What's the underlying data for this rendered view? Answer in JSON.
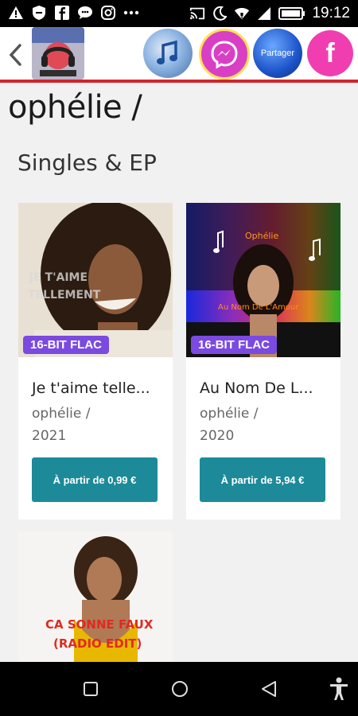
{
  "status_bar": {
    "time": "19:12",
    "icons": [
      "warning-icon",
      "shield-icon",
      "facebook-icon",
      "chat-icon",
      "instagram-icon",
      "more-icon",
      "cast-icon",
      "moon-icon",
      "wifi-icon",
      "signal-icon",
      "battery-icon"
    ]
  },
  "header": {
    "back_icon": "chevron-left-icon",
    "logo": "app-logo",
    "share_label": "Partager",
    "facebook_letter": "f",
    "accent_color": "#d2232a"
  },
  "page": {
    "title": "ophélie /",
    "section_title": "Singles & EP"
  },
  "albums": [
    {
      "title": "Je t'aime telle...",
      "artist": "ophélie /",
      "year": "2021",
      "badge": "16-BIT FLAC",
      "cover_text": [
        "JE T'AIME",
        "TELLEMENT"
      ],
      "button": "À partir de 0,99 €"
    },
    {
      "title": "Au Nom De L...",
      "artist": "ophélie /",
      "year": "2020",
      "badge": "16-BIT FLAC",
      "cover_text": [
        "Ophélie",
        "Au Nom De L'Amour"
      ],
      "button": "À partir de 5,94 €"
    },
    {
      "cover_text": [
        "CA SONNE FAUX",
        "(RADIO EDIT)"
      ]
    }
  ],
  "colors": {
    "button": "#1d8a99",
    "badge": "#7b4ae0"
  },
  "nav": {
    "icons": [
      "recents-icon",
      "home-icon",
      "back-icon",
      "accessibility-icon"
    ]
  }
}
